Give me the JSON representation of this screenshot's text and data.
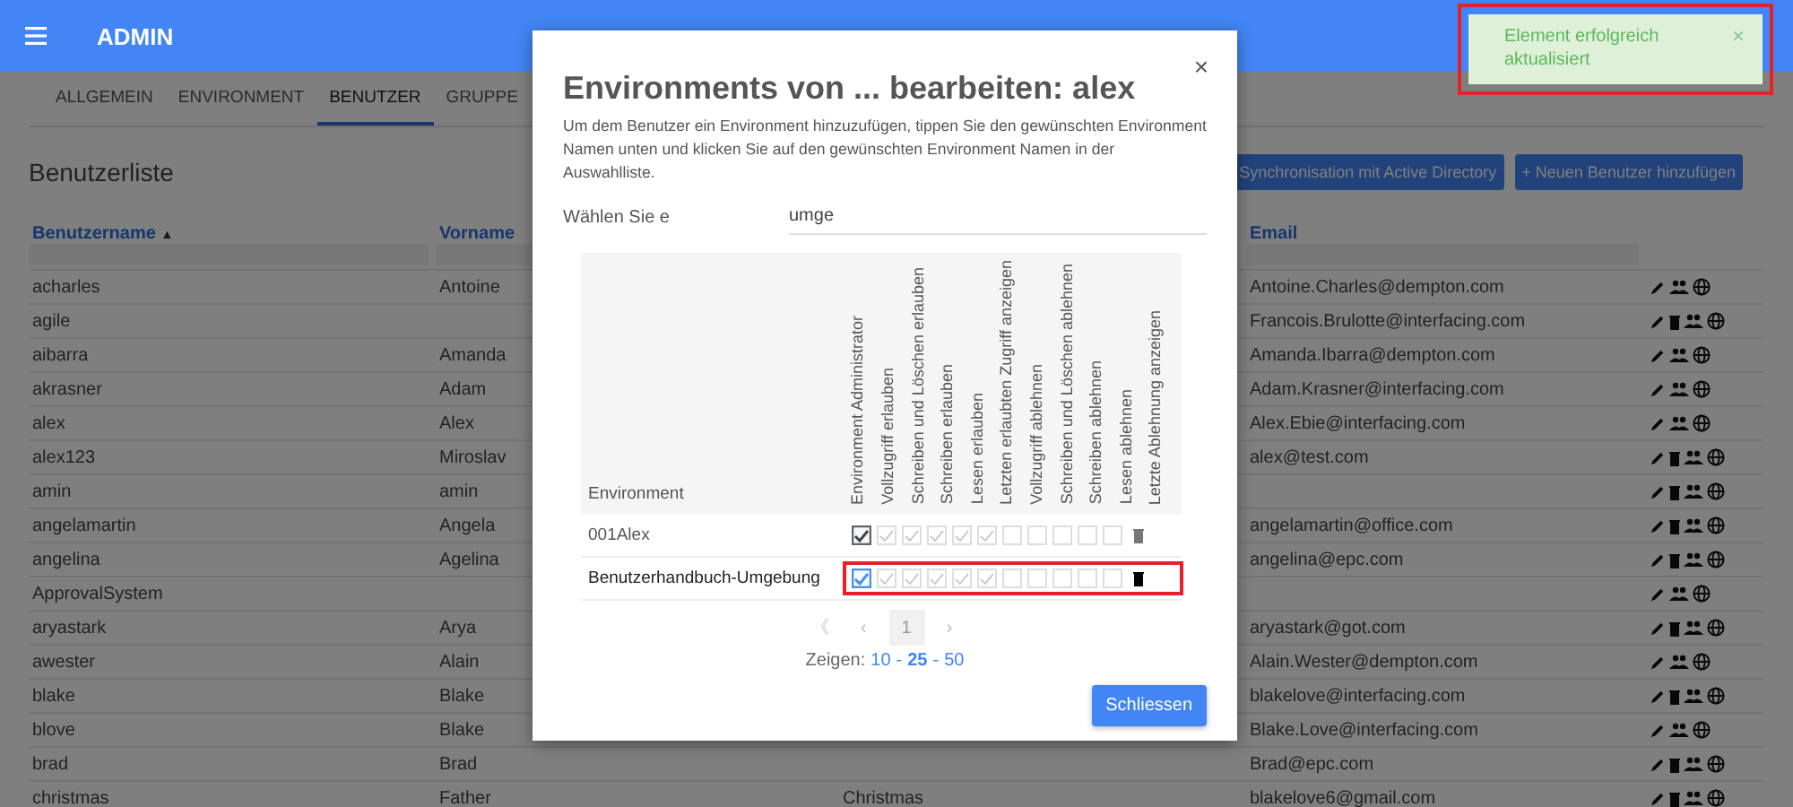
{
  "header": {
    "title": "ADMIN"
  },
  "tabs": [
    {
      "label": "ALLGEMEIN",
      "selected": false
    },
    {
      "label": "ENVIRONMENT",
      "selected": false
    },
    {
      "label": "BENUTZER",
      "selected": true
    },
    {
      "label": "GRUPPE",
      "selected": false
    }
  ],
  "list_title": "Benutzerliste",
  "toolbar_buttons": [
    "Synchronisation mit Active Directory",
    "+ Neuen Benutzer hinzufügen"
  ],
  "table": {
    "columns": [
      {
        "label": "Benutzername",
        "sort_mark": "▲"
      },
      {
        "label": "Vorname"
      },
      {
        "label": "Email"
      }
    ],
    "rows": [
      {
        "username": "acharles",
        "first_name": "Antoine",
        "email": "Antoine.Charles@dempton.com",
        "deletable": false
      },
      {
        "username": "agile",
        "email": "Francois.Brulotte@interfacing.com",
        "deletable": true
      },
      {
        "username": "aibarra",
        "first_name": "Amanda",
        "email": "Amanda.Ibarra@dempton.com",
        "deletable": false
      },
      {
        "username": "akrasner",
        "first_name": "Adam",
        "email": "Adam.Krasner@interfacing.com",
        "deletable": false
      },
      {
        "username": "alex",
        "first_name": "Alex",
        "email": "Alex.Ebie@interfacing.com",
        "deletable": false
      },
      {
        "username": "alex123",
        "first_name": "Miroslav",
        "email": "alex@test.com",
        "deletable": true
      },
      {
        "username": "amin",
        "first_name": "amin",
        "deletable": true
      },
      {
        "username": "angelamartin",
        "first_name": "Angela",
        "email": "angelamartin@office.com",
        "deletable": true
      },
      {
        "username": "angelina",
        "first_name": "Agelina",
        "email": "angelina@epc.com",
        "deletable": true
      },
      {
        "username": "ApprovalSystem",
        "deletable": false
      },
      {
        "username": "aryastark",
        "first_name": "Arya",
        "email": "aryastark@got.com",
        "deletable": true
      },
      {
        "username": "awester",
        "first_name": "Alain",
        "email": "Alain.Wester@dempton.com",
        "deletable": false
      },
      {
        "username": "blake",
        "first_name": "Blake",
        "email": "blakelove@interfacing.com",
        "deletable": true
      },
      {
        "username": "blove",
        "first_name": "Blake",
        "email": "Blake.Love@interfacing.com",
        "deletable": false
      },
      {
        "username": "brad",
        "first_name": "Brad",
        "email": "Brad@epc.com",
        "deletable": true
      },
      {
        "username": "christmas",
        "first_name": "Father",
        "column_3": "Christmas",
        "email": "blakelove6@gmail.com",
        "deletable": true
      }
    ]
  },
  "modal": {
    "close": "×",
    "title": "Environments von ... bearbeiten: alex",
    "description": "Um dem Benutzer ein Environment hinzuzufügen, tippen Sie den gewünschten Environment Namen unten und klicken Sie auf den gewünschten Environment Namen in der Auswahlliste.",
    "select_label": "Wählen Sie e",
    "select_value": "umge",
    "env_column": "Environment",
    "permission_columns": [
      "Environment Administrator",
      "Vollzugriff erlauben",
      "Schreiben und Löschen erlauben",
      "Schreiben erlauben",
      "Lesen erlauben",
      "Letzten erlaubten Zugriff anzeigen",
      "Vollzugriff ablehnen",
      "Schreiben und Löschen ablehnen",
      "Schreiben ablehnen",
      "Lesen ablehnen",
      "Letzte Ablehnung anzeigen"
    ],
    "rows": [
      {
        "name": "001Alex",
        "highlighted": false,
        "permissions": [
          {
            "checked": true,
            "disabled": false,
            "focused": false
          },
          {
            "checked": true,
            "disabled": true,
            "focused": false
          },
          {
            "checked": true,
            "disabled": true,
            "focused": false
          },
          {
            "checked": true,
            "disabled": true,
            "focused": false
          },
          {
            "checked": true,
            "disabled": true,
            "focused": false
          },
          {
            "checked": true,
            "disabled": true,
            "focused": false
          },
          {
            "checked": false,
            "disabled": true,
            "focused": false
          },
          {
            "checked": false,
            "disabled": true,
            "focused": false
          },
          {
            "checked": false,
            "disabled": true,
            "focused": false
          },
          {
            "checked": false,
            "disabled": true,
            "focused": false
          },
          {
            "checked": false,
            "disabled": true,
            "focused": false
          }
        ]
      },
      {
        "name": "Benutzerhandbuch-Umgebung",
        "highlighted": true,
        "permissions": [
          {
            "checked": true,
            "disabled": false,
            "focused": true
          },
          {
            "checked": true,
            "disabled": true,
            "focused": false
          },
          {
            "checked": true,
            "disabled": true,
            "focused": false
          },
          {
            "checked": true,
            "disabled": true,
            "focused": false
          },
          {
            "checked": true,
            "disabled": true,
            "focused": false
          },
          {
            "checked": true,
            "disabled": true,
            "focused": false
          },
          {
            "checked": false,
            "disabled": true,
            "focused": false
          },
          {
            "checked": false,
            "disabled": true,
            "focused": false
          },
          {
            "checked": false,
            "disabled": true,
            "focused": false
          },
          {
            "checked": false,
            "disabled": true,
            "focused": false
          },
          {
            "checked": false,
            "disabled": true,
            "focused": false
          }
        ]
      }
    ],
    "pagination": [
      {
        "label": "《",
        "selected": false
      },
      {
        "label": "‹",
        "selected": false
      },
      {
        "label": "1",
        "selected": true
      },
      {
        "label": "›",
        "selected": false
      }
    ],
    "show_label": "Zeigen:",
    "page_sizes": [
      {
        "label": "10",
        "kind": "size",
        "selected": false
      },
      {
        "label": "-",
        "kind": "separator"
      },
      {
        "label": "25",
        "kind": "size",
        "selected": true
      },
      {
        "label": "-",
        "kind": "separator"
      },
      {
        "label": "50",
        "kind": "size",
        "selected": false
      }
    ],
    "button": "Schliessen"
  },
  "toast": {
    "message": "Element erfolgreich aktualisiert",
    "close": "×",
    "highlighted": true
  }
}
